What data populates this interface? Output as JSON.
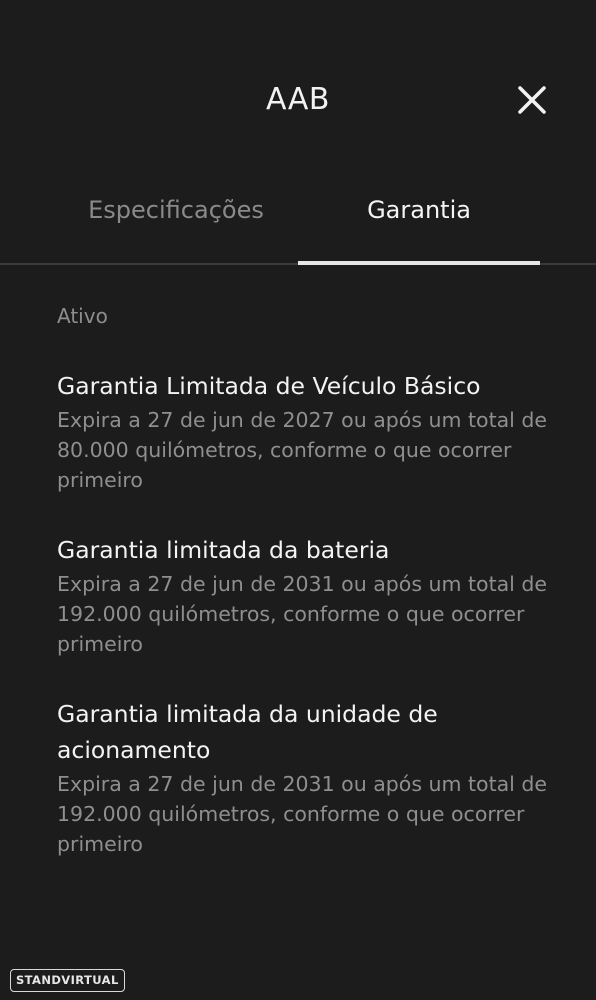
{
  "header": {
    "title": "AAB",
    "close_icon": "close-icon"
  },
  "tabs": [
    {
      "label": "Especificações",
      "active": false
    },
    {
      "label": "Garantia",
      "active": true
    }
  ],
  "section": {
    "label": "Ativo"
  },
  "warranties": [
    {
      "title": "Garantia Limitada de Veículo Básico",
      "description": "Expira a 27 de jun de 2027 ou após um total de 80.000 quilómetros, conforme o que ocorrer primeiro"
    },
    {
      "title": "Garantia limitada da bateria",
      "description": "Expira a 27 de jun de 2031 ou após um total de 192.000 quilómetros, conforme o que ocorrer primeiro"
    },
    {
      "title": "Garantia limitada da unidade de acionamento",
      "description": "Expira a 27 de jun de 2031 ou após um total de 192.000 quilómetros, conforme o que ocorrer primeiro"
    }
  ],
  "watermark": {
    "text": "STANDVIRTUAL"
  },
  "colors": {
    "background": "#1c1c1d",
    "text_primary": "#f3f3f3",
    "text_secondary": "#8f8f91",
    "tab_underline": "#e6e6e6"
  }
}
